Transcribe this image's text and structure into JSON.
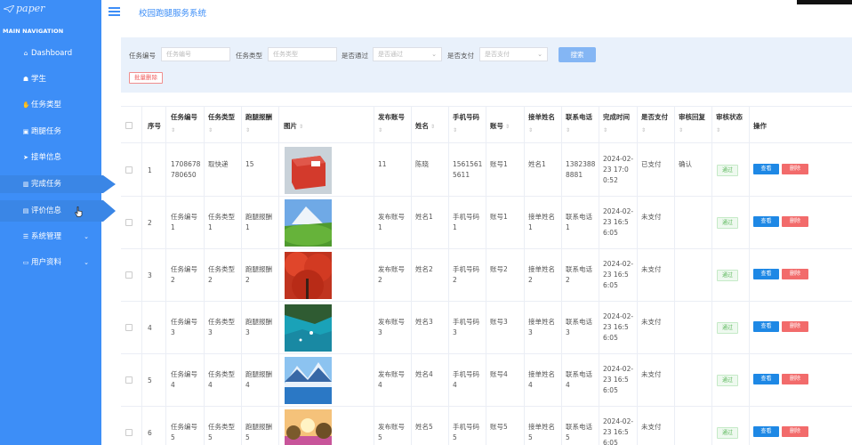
{
  "app": {
    "logo": "paper",
    "title": "校园跑腿服务系统"
  },
  "sidebar": {
    "nav_title": "MAIN NAVIGATION",
    "items": [
      {
        "label": "Dashboard",
        "icon": "home-icon"
      },
      {
        "label": "学生",
        "icon": "user-icon"
      },
      {
        "label": "任务类型",
        "icon": "thumb-icon"
      },
      {
        "label": "跑腿任务",
        "icon": "chat-icon"
      },
      {
        "label": "接单信息",
        "icon": "send-icon"
      },
      {
        "label": "完成任务",
        "icon": "chart-icon"
      },
      {
        "label": "评价信息",
        "icon": "list-icon"
      },
      {
        "label": "系统管理",
        "icon": "settings-icon"
      },
      {
        "label": "用户资料",
        "icon": "profile-icon"
      }
    ]
  },
  "filter": {
    "task_no_label": "任务编号",
    "task_no_placeholder": "任务编号",
    "task_type_label": "任务类型",
    "task_type_placeholder": "任务类型",
    "approved_label": "是否通过",
    "approved_placeholder": "是否通过",
    "paid_label": "是否支付",
    "paid_placeholder": "是否支付",
    "search_label": "搜索",
    "batch_delete_label": "批量删除"
  },
  "table": {
    "headers": {
      "index": "序号",
      "task_no": "任务编号",
      "task_type": "任务类型",
      "reward": "跑腿报酬",
      "image": "图片",
      "publisher": "发布账号",
      "name": "姓名",
      "phone": "手机号码",
      "account": "账号",
      "receiver_name": "接单姓名",
      "contact_phone": "联系电话",
      "finish_time": "完成时间",
      "paid": "是否支付",
      "review_reply": "审核回复",
      "review_status": "审核状态",
      "actions": "操作"
    },
    "rows": [
      {
        "index": "1",
        "task_no": "1708678780650",
        "task_type": "取快递",
        "reward": "15",
        "publisher": "11",
        "name": "陈晓",
        "phone": "15615615611",
        "account": "账号1",
        "receiver_name": "姓名1",
        "contact_phone": "13823888881",
        "finish_time": "2024-02-23 17:00:52",
        "paid": "已支付",
        "review_reply": "确认",
        "review_status": "通过",
        "image": "box-image"
      },
      {
        "index": "2",
        "task_no": "任务编号1",
        "task_type": "任务类型1",
        "reward": "跑腿报酬1",
        "publisher": "发布账号1",
        "name": "姓名1",
        "phone": "手机号码1",
        "account": "账号1",
        "receiver_name": "接单姓名1",
        "contact_phone": "联系电话1",
        "finish_time": "2024-02-23 16:56:05",
        "paid": "未支付",
        "review_reply": "",
        "review_status": "通过",
        "image": "mountain-image"
      },
      {
        "index": "3",
        "task_no": "任务编号2",
        "task_type": "任务类型2",
        "reward": "跑腿报酬2",
        "publisher": "发布账号2",
        "name": "姓名2",
        "phone": "手机号码2",
        "account": "账号2",
        "receiver_name": "接单姓名2",
        "contact_phone": "联系电话2",
        "finish_time": "2024-02-23 16:56:05",
        "paid": "未支付",
        "review_reply": "",
        "review_status": "通过",
        "image": "autumn-tree-image"
      },
      {
        "index": "4",
        "task_no": "任务编号3",
        "task_type": "任务类型3",
        "reward": "跑腿报酬3",
        "publisher": "发布账号3",
        "name": "姓名3",
        "phone": "手机号码3",
        "account": "账号3",
        "receiver_name": "接单姓名3",
        "contact_phone": "联系电话3",
        "finish_time": "2024-02-23 16:56:05",
        "paid": "未支付",
        "review_reply": "",
        "review_status": "通过",
        "image": "bay-image"
      },
      {
        "index": "5",
        "task_no": "任务编号4",
        "task_type": "任务类型4",
        "reward": "跑腿报酬4",
        "publisher": "发布账号4",
        "name": "姓名4",
        "phone": "手机号码4",
        "account": "账号4",
        "receiver_name": "接单姓名4",
        "contact_phone": "联系电话4",
        "finish_time": "2024-02-23 16:56:05",
        "paid": "未支付",
        "review_reply": "",
        "review_status": "通过",
        "image": "lake-image"
      },
      {
        "index": "6",
        "task_no": "任务编号5",
        "task_type": "任务类型5",
        "reward": "跑腿报酬5",
        "publisher": "发布账号5",
        "name": "姓名5",
        "phone": "手机号码5",
        "account": "账号5",
        "receiver_name": "接单姓名5",
        "contact_phone": "联系电话5",
        "finish_time": "2024-02-23 16:56:05",
        "paid": "未支付",
        "review_reply": "",
        "review_status": "通过",
        "image": "sunset-field-image"
      }
    ],
    "view_label": "查看",
    "delete_label": "删除"
  },
  "colors": {
    "sidebar": "#3d8ef7",
    "primary": "#1e88e5",
    "danger": "#f26b6b",
    "success": "#5cb85c"
  }
}
